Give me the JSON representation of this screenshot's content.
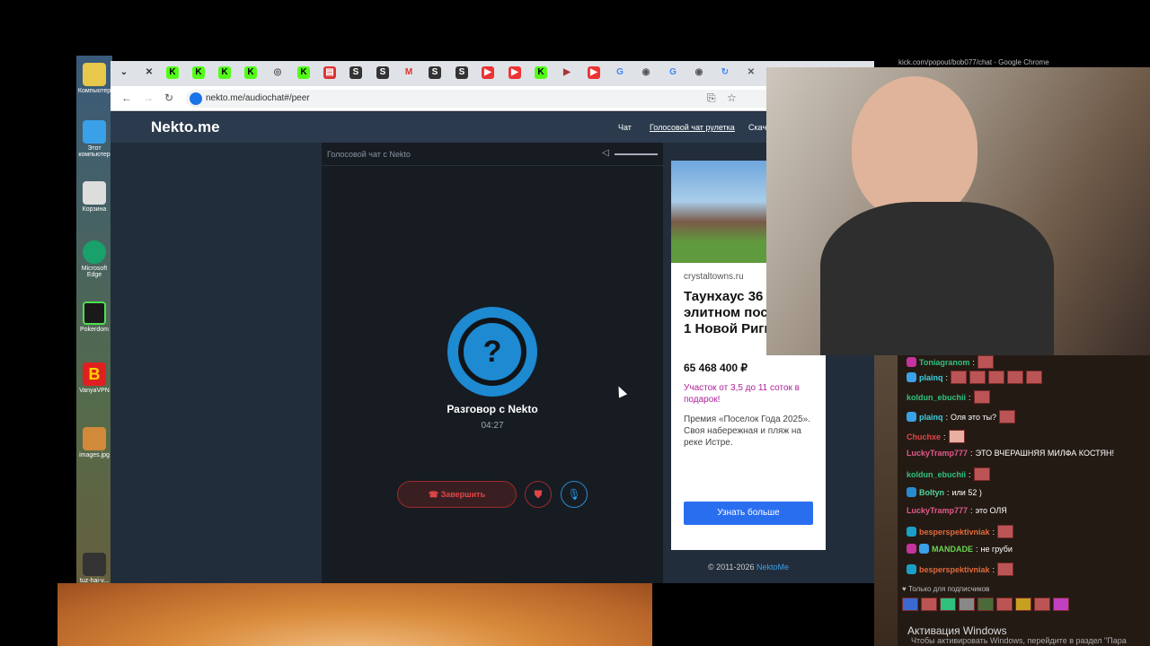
{
  "desktop": {
    "icons": [
      {
        "label": "Компьютер"
      },
      {
        "label": "Этот компьютер"
      },
      {
        "label": "Корзина"
      },
      {
        "label": "Microsoft Edge"
      },
      {
        "label": "Pokerdom"
      },
      {
        "label": "VanyaVPN"
      },
      {
        "label": "images.jpg"
      },
      {
        "label": "tuz-hai-v..."
      }
    ]
  },
  "browser": {
    "url": "nekto.me/audiochat#/peer",
    "background_title": "kick.com/popout/bob077/chat - Google Chrome"
  },
  "nekto": {
    "logo": "Nekto.me",
    "nav": {
      "chat": "Чат",
      "voice_roulette": "Голосовой чат рулетка",
      "download": "Скача"
    },
    "call_panel_title": "Голосовой чат с Nekto",
    "conversation_name": "Разговор с Nekto",
    "timer": "04:27",
    "end_button": "Завершить"
  },
  "ad": {
    "domain": "crystaltowns.ru",
    "title": "Таунхаус 36 в элитном поселке на 1 Новой Риги",
    "price": "65 468 400 ₽",
    "promo": "Участок от 3,5 до 11 соток в подарок!",
    "description": "Премия «Поселок Года 2025». Своя набережная и пляж на реке Истре.",
    "button": "Узнать больше",
    "footer_text": "© 2011-2026",
    "footer_link": "NektoMe"
  },
  "chat": {
    "messages": [
      {
        "user": "Toniagranom",
        "color": "#2ec27e",
        "text": ""
      },
      {
        "user": "plainq",
        "color": "#3ad0e0",
        "text": ""
      },
      {
        "user": "koldun_ebuchii",
        "color": "#2ec27e",
        "text": ""
      },
      {
        "user": "plainq",
        "color": "#3ad0e0",
        "text": "Оля это ты?"
      },
      {
        "user": "Chuchxe",
        "color": "#e04646",
        "text": ""
      },
      {
        "user": "LuckyTramp777",
        "color": "#e05a8a",
        "text": "ЭТО ВЧЕРАШНЯЯ МИЛФА КОСТЯН!"
      },
      {
        "user": "koldun_ebuchii",
        "color": "#2ec27e",
        "text": ""
      },
      {
        "user": "Boltyn",
        "color": "#4fd4a0",
        "text": "или 52 )"
      },
      {
        "user": "LuckyTramp777",
        "color": "#e05a8a",
        "text": "это ОЛЯ"
      },
      {
        "user": "besperspektivniak",
        "color": "#e06a3a",
        "text": ""
      },
      {
        "user": "MANDADE",
        "color": "#6ad44f",
        "text": "не груби"
      },
      {
        "user": "besperspektivniak",
        "color": "#e06a3a",
        "text": ""
      }
    ],
    "subscribers_only": "Только для подписчиков",
    "windows_activation_title": "Активация Windows",
    "windows_activation_text": "Чтобы активировать Windows, перейдите в раздел \"Пара"
  }
}
